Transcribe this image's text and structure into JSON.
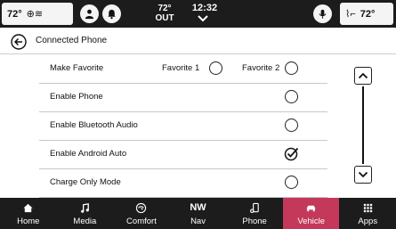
{
  "status_bar": {
    "driver_temp": "72°",
    "passenger_temp": "72°",
    "outside_temp_value": "72°",
    "outside_temp_label": "OUT",
    "time": "12:32",
    "icons": [
      "heated-steering-icon",
      "driver-profile-icon",
      "voice-icon",
      "passenger-profile-icon",
      "heated-seat-icon"
    ]
  },
  "header": {
    "title": "Connected Phone"
  },
  "settings": {
    "make_favorite": {
      "label": "Make Favorite",
      "option1": "Favorite 1",
      "option2": "Favorite 2"
    },
    "rows": [
      {
        "label": "Enable Phone",
        "checked": false
      },
      {
        "label": "Enable Bluetooth Audio",
        "checked": false
      },
      {
        "label": "Enable Android Auto",
        "checked": true
      },
      {
        "label": "Charge Only Mode",
        "checked": false
      }
    ]
  },
  "nav": {
    "items": [
      {
        "label": "Home",
        "icon": "home-icon"
      },
      {
        "label": "Media",
        "icon": "music-note-icon"
      },
      {
        "label": "Comfort",
        "icon": "comfort-icon"
      },
      {
        "label": "Nav",
        "icon": "compass-icon",
        "icon_text": "NW"
      },
      {
        "label": "Phone",
        "icon": "phone-icon"
      },
      {
        "label": "Vehicle",
        "icon": "car-icon",
        "active": true
      },
      {
        "label": "Apps",
        "icon": "apps-grid-icon"
      }
    ]
  },
  "colors": {
    "bar_background": "#1c1c1c",
    "active_tab": "#c4385a",
    "page_background": "#ffffff"
  }
}
